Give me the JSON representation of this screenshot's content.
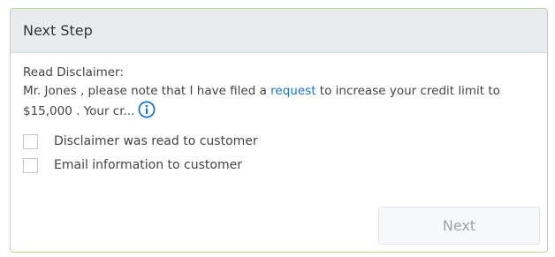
{
  "panel": {
    "title": "Next Step"
  },
  "disclaimer": {
    "label": "Read Disclaimer:",
    "text_before_link": "Mr. Jones , please note that I have filed a ",
    "link_text": "request",
    "text_after_link": " to increase your credit limit to $15,000 . Your cr...",
    "info_icon": "info-icon"
  },
  "options": [
    {
      "label": "Disclaimer was read to customer",
      "checked": false
    },
    {
      "label": "Email information to customer",
      "checked": false
    }
  ],
  "actions": {
    "next_label": "Next"
  },
  "colors": {
    "header_bg": "#e9ecef",
    "border_accent": "#b9d98c",
    "link": "#1a73c8"
  }
}
